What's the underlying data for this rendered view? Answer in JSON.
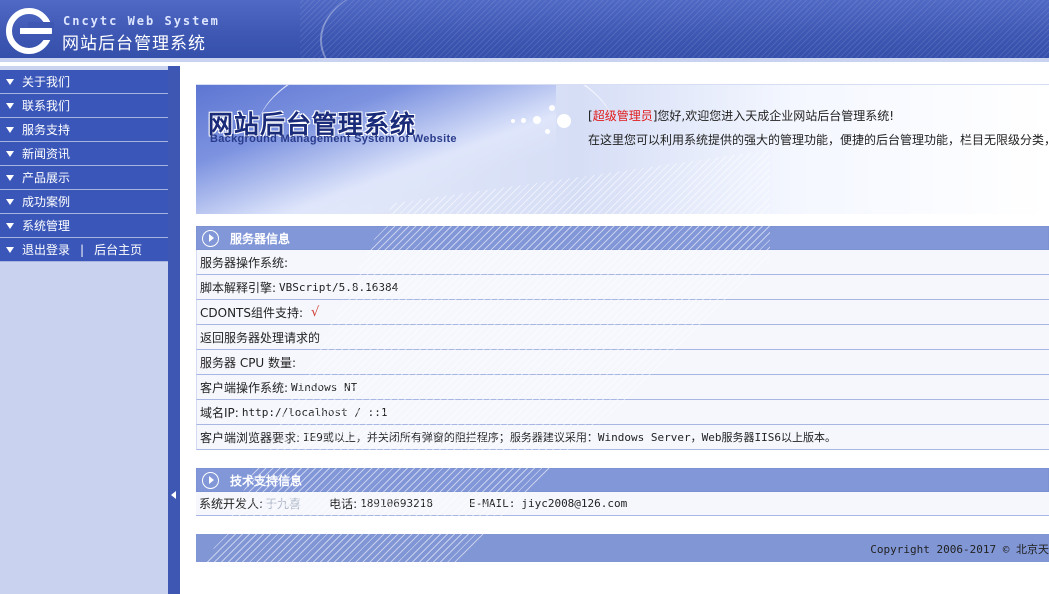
{
  "header": {
    "logo_en": "Cncytc Web System",
    "logo_cn": "网站后台管理系统"
  },
  "sidebar": {
    "items": [
      {
        "label": "关于我们"
      },
      {
        "label": "联系我们"
      },
      {
        "label": "服务支持"
      },
      {
        "label": "新闻资讯"
      },
      {
        "label": "产品展示"
      },
      {
        "label": "成功案例"
      },
      {
        "label": "系统管理"
      }
    ],
    "logout": "退出登录",
    "separator": "|",
    "home": "后台主页"
  },
  "welcome": {
    "title": "网站后台管理系统",
    "subtitle": "Background Management System of Website",
    "bracket_open": "[",
    "role": "超级管理员",
    "greeting": "]您好,欢迎您进入天成企业网站后台管理系统!",
    "description": "在这里您可以利用系统提供的强大的管理功能，便捷的后台管理功能，栏目无限级分类，"
  },
  "server_info": {
    "title": "服务器信息",
    "rows": [
      {
        "label": "服务器操作系统:",
        "value": ""
      },
      {
        "label": "脚本解释引擎:",
        "value": "VBScript/5.8.16384"
      },
      {
        "label": "CDONTS组件支持:",
        "value": "√"
      },
      {
        "label": "返回服务器处理请求的",
        "value": ""
      },
      {
        "label": "服务器 CPU 数量:",
        "value": ""
      },
      {
        "label": "客户端操作系统:",
        "value": "Windows NT"
      },
      {
        "label": "域名IP:",
        "value": "http://localhost  /  ::1"
      },
      {
        "label": "客户端浏览器要求:",
        "value": "IE9或以上，并关闭所有弹窗的阻拦程序；服务器建议采用：Windows Server，Web服务器IIS6以上版本。"
      }
    ]
  },
  "tech_support": {
    "title": "技术支持信息",
    "developer_label": "系统开发人:",
    "developer": "于九喜",
    "phone_label": "电话:",
    "phone": "18910693218",
    "email_label": "E-MAIL:",
    "email": "jiyc2008@126.com"
  },
  "footer": {
    "copyright": "Copyright 2006-2017 © 北京天"
  },
  "colors": {
    "header_blue": "#3d57b3",
    "sidebar_bg": "#c9d2ee",
    "panel_head": "#8297d7",
    "role_red": "#e01b1b"
  }
}
